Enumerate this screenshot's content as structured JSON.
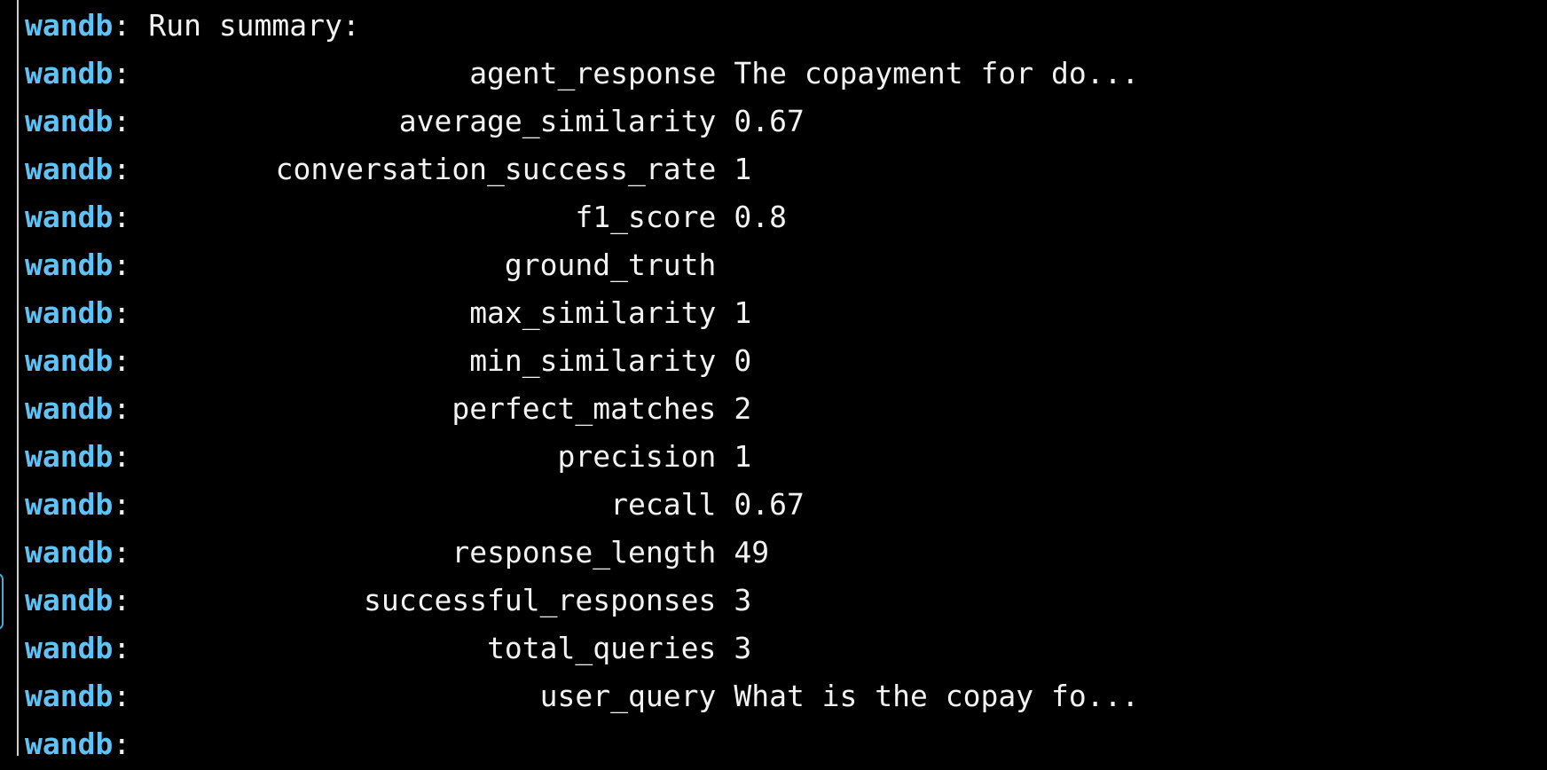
{
  "prefix": "wandb",
  "separator": ":",
  "header": "Run summary:",
  "summary": [
    {
      "key": "agent_response",
      "value": "The copayment for do..."
    },
    {
      "key": "average_similarity",
      "value": "0.67"
    },
    {
      "key": "conversation_success_rate",
      "value": "1"
    },
    {
      "key": "f1_score",
      "value": "0.8"
    },
    {
      "key": "ground_truth",
      "value": ""
    },
    {
      "key": "max_similarity",
      "value": "1"
    },
    {
      "key": "min_similarity",
      "value": "0"
    },
    {
      "key": "perfect_matches",
      "value": "2"
    },
    {
      "key": "precision",
      "value": "1"
    },
    {
      "key": "recall",
      "value": "0.67"
    },
    {
      "key": "response_length",
      "value": "49"
    },
    {
      "key": "successful_responses",
      "value": "3"
    },
    {
      "key": "total_queries",
      "value": "3"
    },
    {
      "key": "user_query",
      "value": "What is the copay fo..."
    }
  ],
  "colors": {
    "background": "#000000",
    "prefix": "#5fc3f5",
    "text": "#f2f2f2"
  }
}
